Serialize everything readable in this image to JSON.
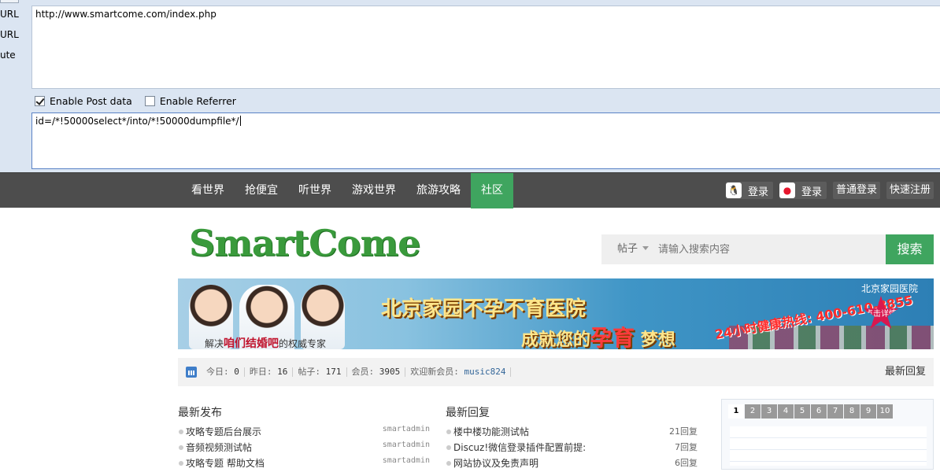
{
  "tool": {
    "side_labels": [
      "URL",
      "URL",
      "ute"
    ],
    "url_value": "http://www.smartcome.com/index.php",
    "enable_post_label": "Enable Post data",
    "enable_post_checked": true,
    "enable_referrer_label": "Enable Referrer",
    "enable_referrer_checked": false,
    "post_value": "id=/*!50000select*/into/*!50000dumpfile*/"
  },
  "nav": {
    "items": [
      "看世界",
      "抢便宜",
      "听世界",
      "游戏世界",
      "旅游攻略",
      "社区"
    ],
    "active_index": 5,
    "qq_login": "登录",
    "weibo_login": "登录",
    "normal_login": "普通登录",
    "quick_register": "快速注册"
  },
  "header": {
    "logo_text": "SmartCome",
    "search_type": "帖子",
    "search_placeholder": "请输入搜索内容",
    "search_button": "搜索"
  },
  "banner": {
    "headline": "北京家园不孕不育医院",
    "slogan_pre": "成就您的",
    "slogan_em": "孕育",
    "slogan_post": "梦想",
    "tagline_pre": "解决",
    "tagline_em": "咱们结婚吧",
    "tagline_post": "的权威专家",
    "hotline": "24小时健康热线: 400-610-8855",
    "hospital_name": "北京家园医院",
    "click_badge": "点击详情"
  },
  "stats": {
    "today_label": "今日:",
    "today_value": "0",
    "yesterday_label": "昨日:",
    "yesterday_value": "16",
    "posts_label": "帖子:",
    "posts_value": "171",
    "members_label": "会员:",
    "members_value": "3905",
    "welcome_label": "欢迎新会员:",
    "new_member": "music824",
    "latest_reply_link": "最新回复"
  },
  "latest_posts": {
    "title": "最新发布",
    "items": [
      {
        "text": "攻略专题后台展示",
        "author": "smartadmin"
      },
      {
        "text": "音频视频测试帖",
        "author": "smartadmin"
      },
      {
        "text": "攻略专题 帮助文档",
        "author": "smartadmin"
      }
    ]
  },
  "latest_replies": {
    "title": "最新回复",
    "items": [
      {
        "text": "楼中楼功能测试帖",
        "count": "21回复"
      },
      {
        "text": "Discuz!微信登录插件配置前提:",
        "count": "7回复"
      },
      {
        "text": "网站协议及免责声明",
        "count": "6回复"
      }
    ]
  },
  "slide": {
    "pages": [
      "1",
      "2",
      "3",
      "4",
      "5",
      "6",
      "7",
      "8",
      "9",
      "10"
    ],
    "current": "1"
  }
}
